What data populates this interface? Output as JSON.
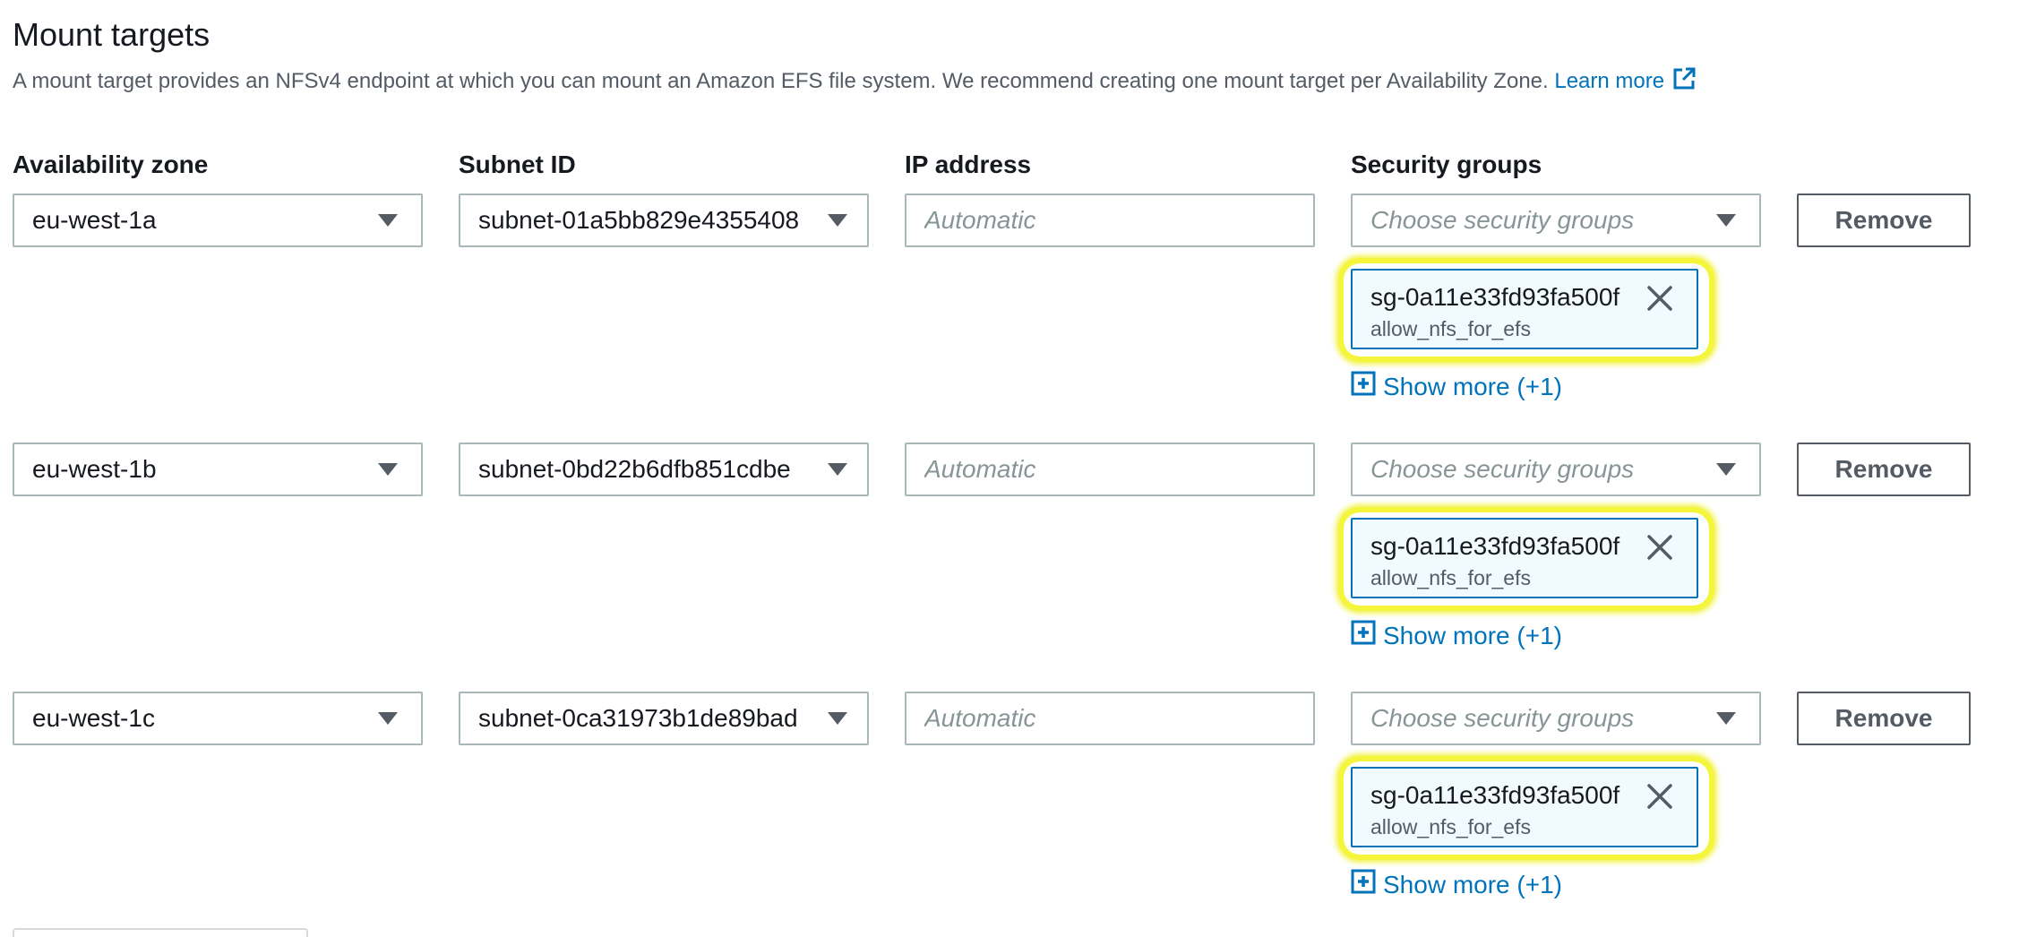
{
  "section": {
    "title": "Mount targets",
    "description": "A mount target provides an NFSv4 endpoint at which you can mount an Amazon EFS file system. We recommend creating one mount target per Availability Zone.",
    "learn_more": "Learn more"
  },
  "columns": {
    "availability_zone": "Availability zone",
    "subnet_id": "Subnet ID",
    "ip_address": "IP address",
    "security_groups": "Security groups"
  },
  "rows": [
    {
      "zone": "eu-west-1a",
      "subnet": "subnet-01a5bb829e4355408",
      "ip_placeholder": "Automatic",
      "sg_placeholder": "Choose security groups",
      "token_id": "sg-0a11e33fd93fa500f",
      "token_name": "allow_nfs_for_efs",
      "show_more": "Show more (+1)",
      "remove": "Remove"
    },
    {
      "zone": "eu-west-1b",
      "subnet": "subnet-0bd22b6dfb851cdbe",
      "ip_placeholder": "Automatic",
      "sg_placeholder": "Choose security groups",
      "token_id": "sg-0a11e33fd93fa500f",
      "token_name": "allow_nfs_for_efs",
      "show_more": "Show more (+1)",
      "remove": "Remove"
    },
    {
      "zone": "eu-west-1c",
      "subnet": "subnet-0ca31973b1de89bad",
      "ip_placeholder": "Automatic",
      "sg_placeholder": "Choose security groups",
      "token_id": "sg-0a11e33fd93fa500f",
      "token_name": "allow_nfs_for_efs",
      "show_more": "Show more (+1)",
      "remove": "Remove"
    }
  ],
  "colors": {
    "link": "#0073bb",
    "highlight": "#f5f53c",
    "token_bg": "#f1faff"
  },
  "icons": {
    "external_link": "external-link-icon",
    "dropdown": "caret-down-icon",
    "token_close": "close-icon",
    "expand": "plus-square-icon"
  }
}
